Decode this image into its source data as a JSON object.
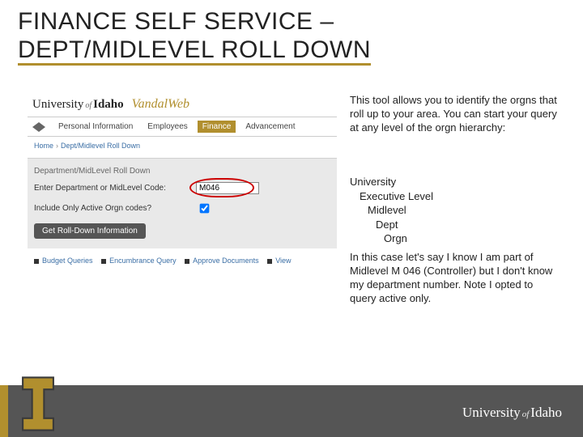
{
  "title_line1": "FINANCE SELF SERVICE –",
  "title_line2": "DEPT/MIDLEVEL ROLL DOWN",
  "intro": "This tool allows you to identify the orgns that roll up to your area.  You can start your query at any level of the orgn hierarchy:",
  "hierarchy": [
    "University",
    "Executive Level",
    "Midlevel",
    "Dept",
    "Orgn"
  ],
  "para2": "In this case let's say I know I am part of Midlevel M 046 (Controller) but I don't know my department number.  Note I opted to query active only.",
  "shot": {
    "brand_university": "University",
    "brand_of": "of",
    "brand_idaho": "Idaho",
    "brand_vandal": "VandalWeb",
    "tabs": [
      "Personal Information",
      "Employees",
      "Finance",
      "Advancement"
    ],
    "active_tab": "Finance",
    "crumb_home": "Home",
    "crumb_page": "Dept/Midlevel Roll Down",
    "form_title": "Department/MidLevel Roll Down",
    "label_code": "Enter Department or MidLevel Code:",
    "code_value": "M046",
    "label_active": "Include Only Active Orgn codes?",
    "button": "Get Roll-Down Information",
    "links": [
      "Budget Queries",
      "Encumbrance Query",
      "Approve Documents",
      "View"
    ]
  },
  "footer_uni": {
    "u": "University",
    "of": "of",
    "i": "Idaho"
  }
}
